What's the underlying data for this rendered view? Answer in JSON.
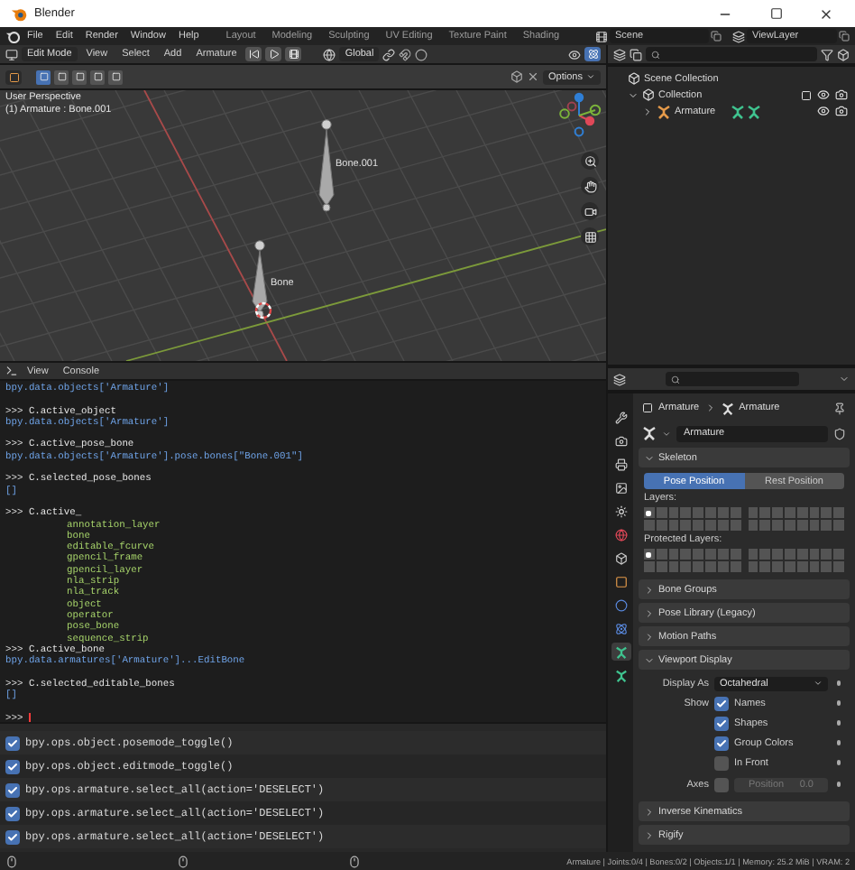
{
  "window": {
    "title": "Blender"
  },
  "menu": [
    "File",
    "Edit",
    "Render",
    "Window",
    "Help"
  ],
  "workspaces": [
    {
      "label": "Layout",
      "selected": false
    },
    {
      "label": "Modeling",
      "selected": false
    },
    {
      "label": "Sculpting",
      "selected": false
    },
    {
      "label": "UV Editing",
      "selected": false
    },
    {
      "label": "Texture Paint",
      "selected": false
    },
    {
      "label": "Shading",
      "selected": false
    }
  ],
  "scene": "Scene",
  "view_layer": "ViewLayer",
  "viewport": {
    "mode": "Edit Mode",
    "menus": [
      "View",
      "Select",
      "Add",
      "Armature"
    ],
    "orientation": "Global",
    "options": "Options",
    "select_modes": [
      {
        "selected": true
      },
      {
        "selected": false
      },
      {
        "selected": false
      },
      {
        "selected": false
      },
      {
        "selected": false
      }
    ],
    "perspective": "User Perspective",
    "context": "(1) Armature : Bone.001",
    "bones": [
      {
        "label": "Bone.001"
      },
      {
        "label": "Bone"
      }
    ]
  },
  "console": {
    "menus": [
      "View",
      "Console"
    ],
    "lines": [
      {
        "kind": "output",
        "text": "bpy.data.objects['Armature']"
      },
      {
        "kind": "blank"
      },
      {
        "kind": "input",
        "text": ">>> C.active_object"
      },
      {
        "kind": "output",
        "text": "bpy.data.objects['Armature']"
      },
      {
        "kind": "blank"
      },
      {
        "kind": "input",
        "text": ">>> C.active_pose_bone"
      },
      {
        "kind": "output",
        "text": "bpy.data.objects['Armature'].pose.bones[\"Bone.001\"]"
      },
      {
        "kind": "blank"
      },
      {
        "kind": "input",
        "text": ">>> C.selected_pose_bones"
      },
      {
        "kind": "output",
        "text": "[]"
      },
      {
        "kind": "blank"
      },
      {
        "kind": "input",
        "text": ">>> C.active_"
      },
      {
        "kind": "completion",
        "text": "annotation_layer"
      },
      {
        "kind": "completion",
        "text": "bone"
      },
      {
        "kind": "completion",
        "text": "editable_fcurve"
      },
      {
        "kind": "completion",
        "text": "gpencil_frame"
      },
      {
        "kind": "completion",
        "text": "gpencil_layer"
      },
      {
        "kind": "completion",
        "text": "nla_strip"
      },
      {
        "kind": "completion",
        "text": "nla_track"
      },
      {
        "kind": "completion",
        "text": "object"
      },
      {
        "kind": "completion",
        "text": "operator"
      },
      {
        "kind": "completion",
        "text": "pose_bone"
      },
      {
        "kind": "completion",
        "text": "sequence_strip"
      },
      {
        "kind": "input",
        "text": ">>> C.active_bone"
      },
      {
        "kind": "output",
        "text": "bpy.data.armatures['Armature']...EditBone"
      },
      {
        "kind": "blank"
      },
      {
        "kind": "input",
        "text": ">>> C.selected_editable_bones"
      },
      {
        "kind": "output",
        "text": "[]"
      },
      {
        "kind": "blank"
      },
      {
        "kind": "prompt",
        "text": ">>>"
      }
    ]
  },
  "info": [
    {
      "text": "bpy.ops.object.posemode_toggle()",
      "checked": true
    },
    {
      "text": "bpy.ops.object.editmode_toggle()",
      "checked": true
    },
    {
      "text": "bpy.ops.armature.select_all(action='DESELECT')",
      "checked": true
    },
    {
      "text": "bpy.ops.armature.select_all(action='DESELECT')",
      "checked": true
    },
    {
      "text": "bpy.ops.armature.select_all(action='DESELECT')",
      "checked": true
    }
  ],
  "outliner": {
    "items": [
      {
        "label": "Scene Collection",
        "children": [
          {
            "label": "Collection",
            "expanded": true,
            "children": [
              {
                "label": "Armature",
                "expanded": false
              }
            ]
          }
        ]
      }
    ]
  },
  "properties": {
    "tabs": [
      {
        "selected": false
      },
      {
        "selected": false
      },
      {
        "selected": false
      },
      {
        "selected": false
      },
      {
        "selected": false
      },
      {
        "selected": false
      },
      {
        "selected": false
      },
      {
        "selected": false
      },
      {
        "selected": false
      },
      {
        "selected": false
      },
      {
        "selected": true
      },
      {
        "selected": false
      }
    ],
    "breadcrumb": [
      {
        "label": "Armature"
      },
      {
        "label": "Armature"
      }
    ],
    "datablock": "Armature",
    "panels": [
      {
        "kind": "skeleton",
        "title": "Skeleton",
        "expanded": true,
        "positions": [
          {
            "label": "Pose Position",
            "selected": true
          },
          {
            "label": "Rest Position",
            "selected": false
          }
        ],
        "layers_label": "Layers:",
        "layers": [
          {
            "on": true
          },
          {
            "on": false
          },
          {
            "on": false
          },
          {
            "on": false
          },
          {
            "on": false
          },
          {
            "on": false
          },
          {
            "on": false
          },
          {
            "on": false
          },
          {
            "on": false
          },
          {
            "on": false
          },
          {
            "on": false
          },
          {
            "on": false
          },
          {
            "on": false
          },
          {
            "on": false
          },
          {
            "on": false
          },
          {
            "on": false
          },
          {
            "on": false
          },
          {
            "on": false
          },
          {
            "on": false
          },
          {
            "on": false
          },
          {
            "on": false
          },
          {
            "on": false
          },
          {
            "on": false
          },
          {
            "on": false
          },
          {
            "on": false
          },
          {
            "on": false
          },
          {
            "on": false
          },
          {
            "on": false
          },
          {
            "on": false
          },
          {
            "on": false
          },
          {
            "on": false
          },
          {
            "on": false
          }
        ],
        "protected_label": "Protected Layers:",
        "protected": [
          {
            "on": true
          },
          {
            "on": false
          },
          {
            "on": false
          },
          {
            "on": false
          },
          {
            "on": false
          },
          {
            "on": false
          },
          {
            "on": false
          },
          {
            "on": false
          },
          {
            "on": false
          },
          {
            "on": false
          },
          {
            "on": false
          },
          {
            "on": false
          },
          {
            "on": false
          },
          {
            "on": false
          },
          {
            "on": false
          },
          {
            "on": false
          },
          {
            "on": false
          },
          {
            "on": false
          },
          {
            "on": false
          },
          {
            "on": false
          },
          {
            "on": false
          },
          {
            "on": false
          },
          {
            "on": false
          },
          {
            "on": false
          },
          {
            "on": false
          },
          {
            "on": false
          },
          {
            "on": false
          },
          {
            "on": false
          },
          {
            "on": false
          },
          {
            "on": false
          },
          {
            "on": false
          },
          {
            "on": false
          }
        ]
      },
      {
        "kind": "plain",
        "title": "Bone Groups",
        "expanded": false
      },
      {
        "kind": "plain",
        "title": "Pose Library (Legacy)",
        "expanded": false
      },
      {
        "kind": "plain",
        "title": "Motion Paths",
        "expanded": false
      },
      {
        "kind": "display",
        "title": "Viewport Display",
        "expanded": true,
        "display_as_label": "Display As",
        "display_as": "Octahedral",
        "show_label": "Show",
        "show": [
          {
            "label": "Names",
            "checked": true
          },
          {
            "label": "Shapes",
            "checked": true
          },
          {
            "label": "Group Colors",
            "checked": true
          },
          {
            "label": "In Front",
            "checked": false
          }
        ],
        "axes": {
          "label": "Axes",
          "checked": false
        },
        "position": {
          "label": "Position",
          "value": "0.0",
          "disabled": true
        }
      },
      {
        "kind": "plain",
        "title": "Inverse Kinematics",
        "expanded": false
      },
      {
        "kind": "plain",
        "title": "Rigify",
        "expanded": false
      }
    ]
  },
  "status_bar": "Armature | Joints:0/4 | Bones:0/2 | Objects:1/1 | Memory: 25.2 MiB | VRAM: 2"
}
